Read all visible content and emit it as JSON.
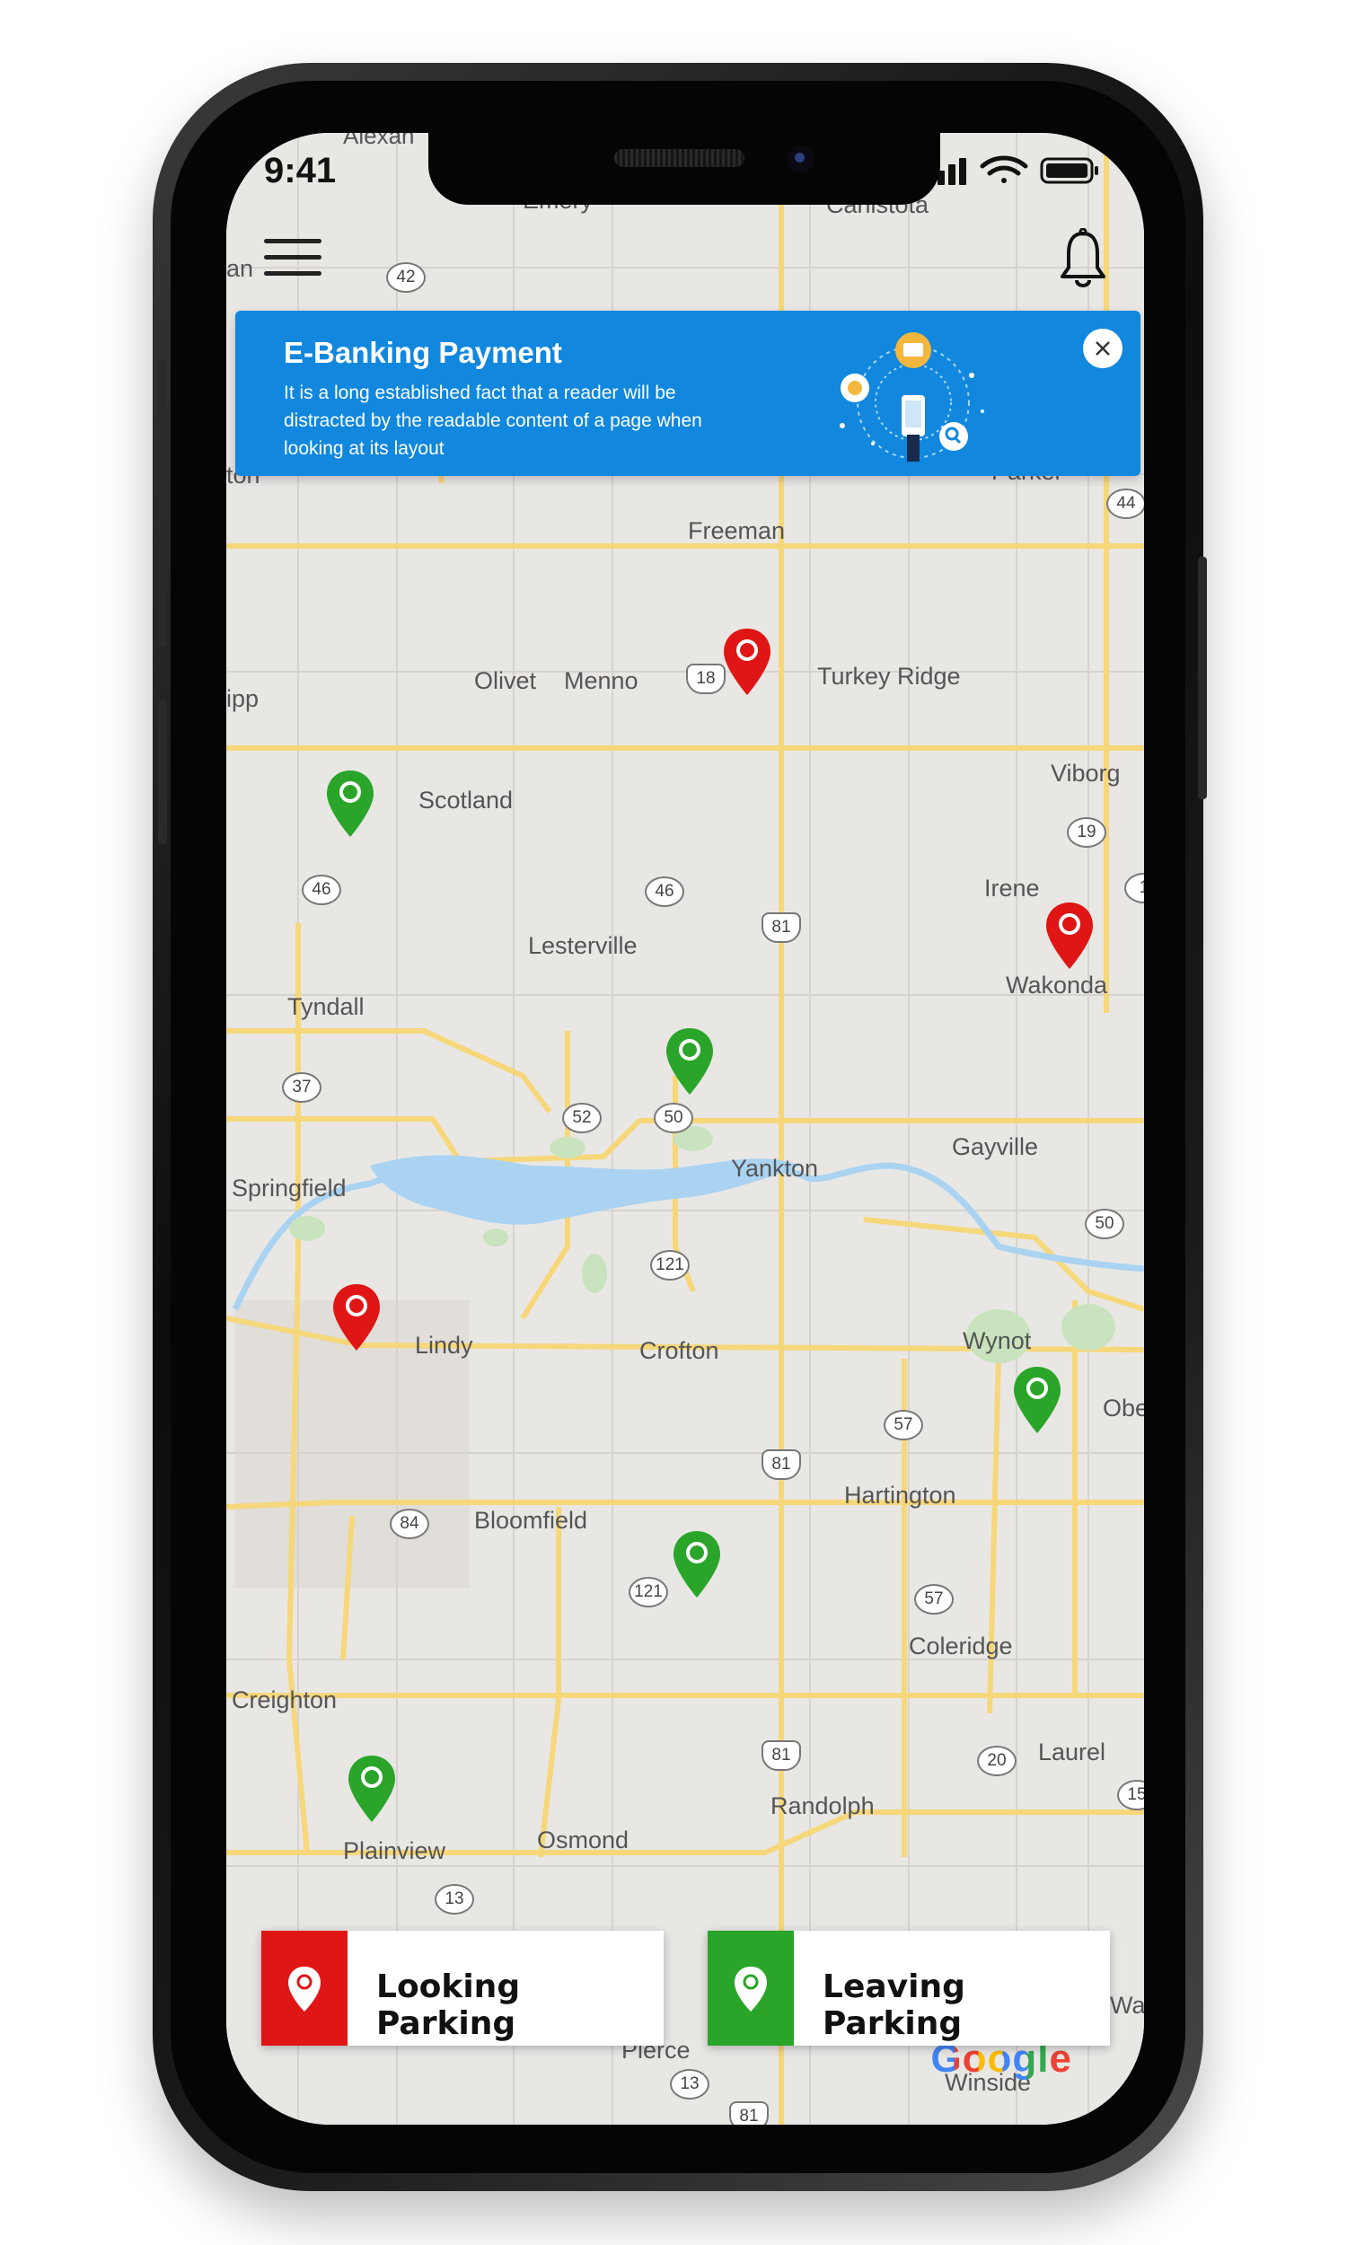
{
  "status_bar": {
    "time": "9:41"
  },
  "banner": {
    "title": "E-Banking Payment",
    "text": "It is a long established fact that a reader will be distracted by the readable content of a page when looking at its layout"
  },
  "map": {
    "places": [
      "Alexan",
      "Emery",
      "Canistota",
      "Freeman",
      "Olivet",
      "Menno",
      "Turkey Ridge",
      "Viborg",
      "ipp",
      "Scotland",
      "Irene",
      "Lesterville",
      "Wakonda",
      "Tyndall",
      "Yankton",
      "Gayville",
      "Springfield",
      "Lindy",
      "Crofton",
      "Wynot",
      "Obe",
      "Hartington",
      "Bloomfield",
      "Coleridge",
      "Creighton",
      "Laurel",
      "Randolph",
      "Plainview",
      "Osmond",
      "Pierce",
      "Winside",
      "Parker",
      "Wa",
      "an",
      "ton"
    ],
    "route_shields": [
      "42",
      "44",
      "18",
      "19",
      "46",
      "46",
      "81",
      "37",
      "52",
      "50",
      "50",
      "121",
      "57",
      "81",
      "84",
      "121",
      "57",
      "81",
      "20",
      "15",
      "13",
      "13",
      "81",
      "1"
    ],
    "attribution": "Google"
  },
  "pins": {
    "looking": [
      "pin-1",
      "pin-2",
      "pin-3"
    ],
    "leaving": [
      "pin-1",
      "pin-2",
      "pin-3",
      "pin-4",
      "pin-5"
    ]
  },
  "actions": {
    "looking_label": "Looking Parking",
    "leaving_label": "Leaving Parking"
  },
  "colors": {
    "looking": "#e01515",
    "leaving": "#2aa52a",
    "banner": "#1187dd",
    "road": "#f6d77a"
  }
}
